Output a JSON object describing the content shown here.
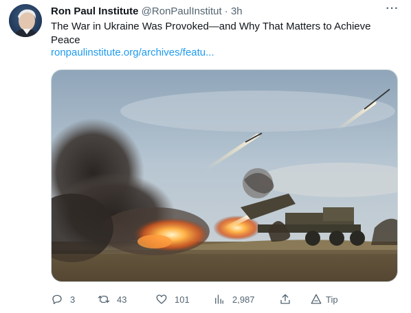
{
  "tweet": {
    "author_name": "Ron Paul Institute",
    "handle": "@RonPaulInstitut",
    "separator": "·",
    "time": "3h",
    "more_label": "···",
    "text": "The War in Ukraine Was Provoked—and Why That Matters to Achieve Peace",
    "link_text": "ronpaulinstitute.org/archives/featu..."
  },
  "actions": {
    "replies": "3",
    "retweets": "43",
    "likes": "101",
    "views": "2,987",
    "tip": "Tip"
  },
  "icons": {
    "reply": "reply-icon",
    "retweet": "retweet-icon",
    "like": "heart-icon",
    "views": "views-icon",
    "share": "share-icon",
    "tip": "tip-icon"
  },
  "colors": {
    "link": "#1d9bf0",
    "secondary_text": "#536471",
    "primary_text": "#0f1419"
  }
}
